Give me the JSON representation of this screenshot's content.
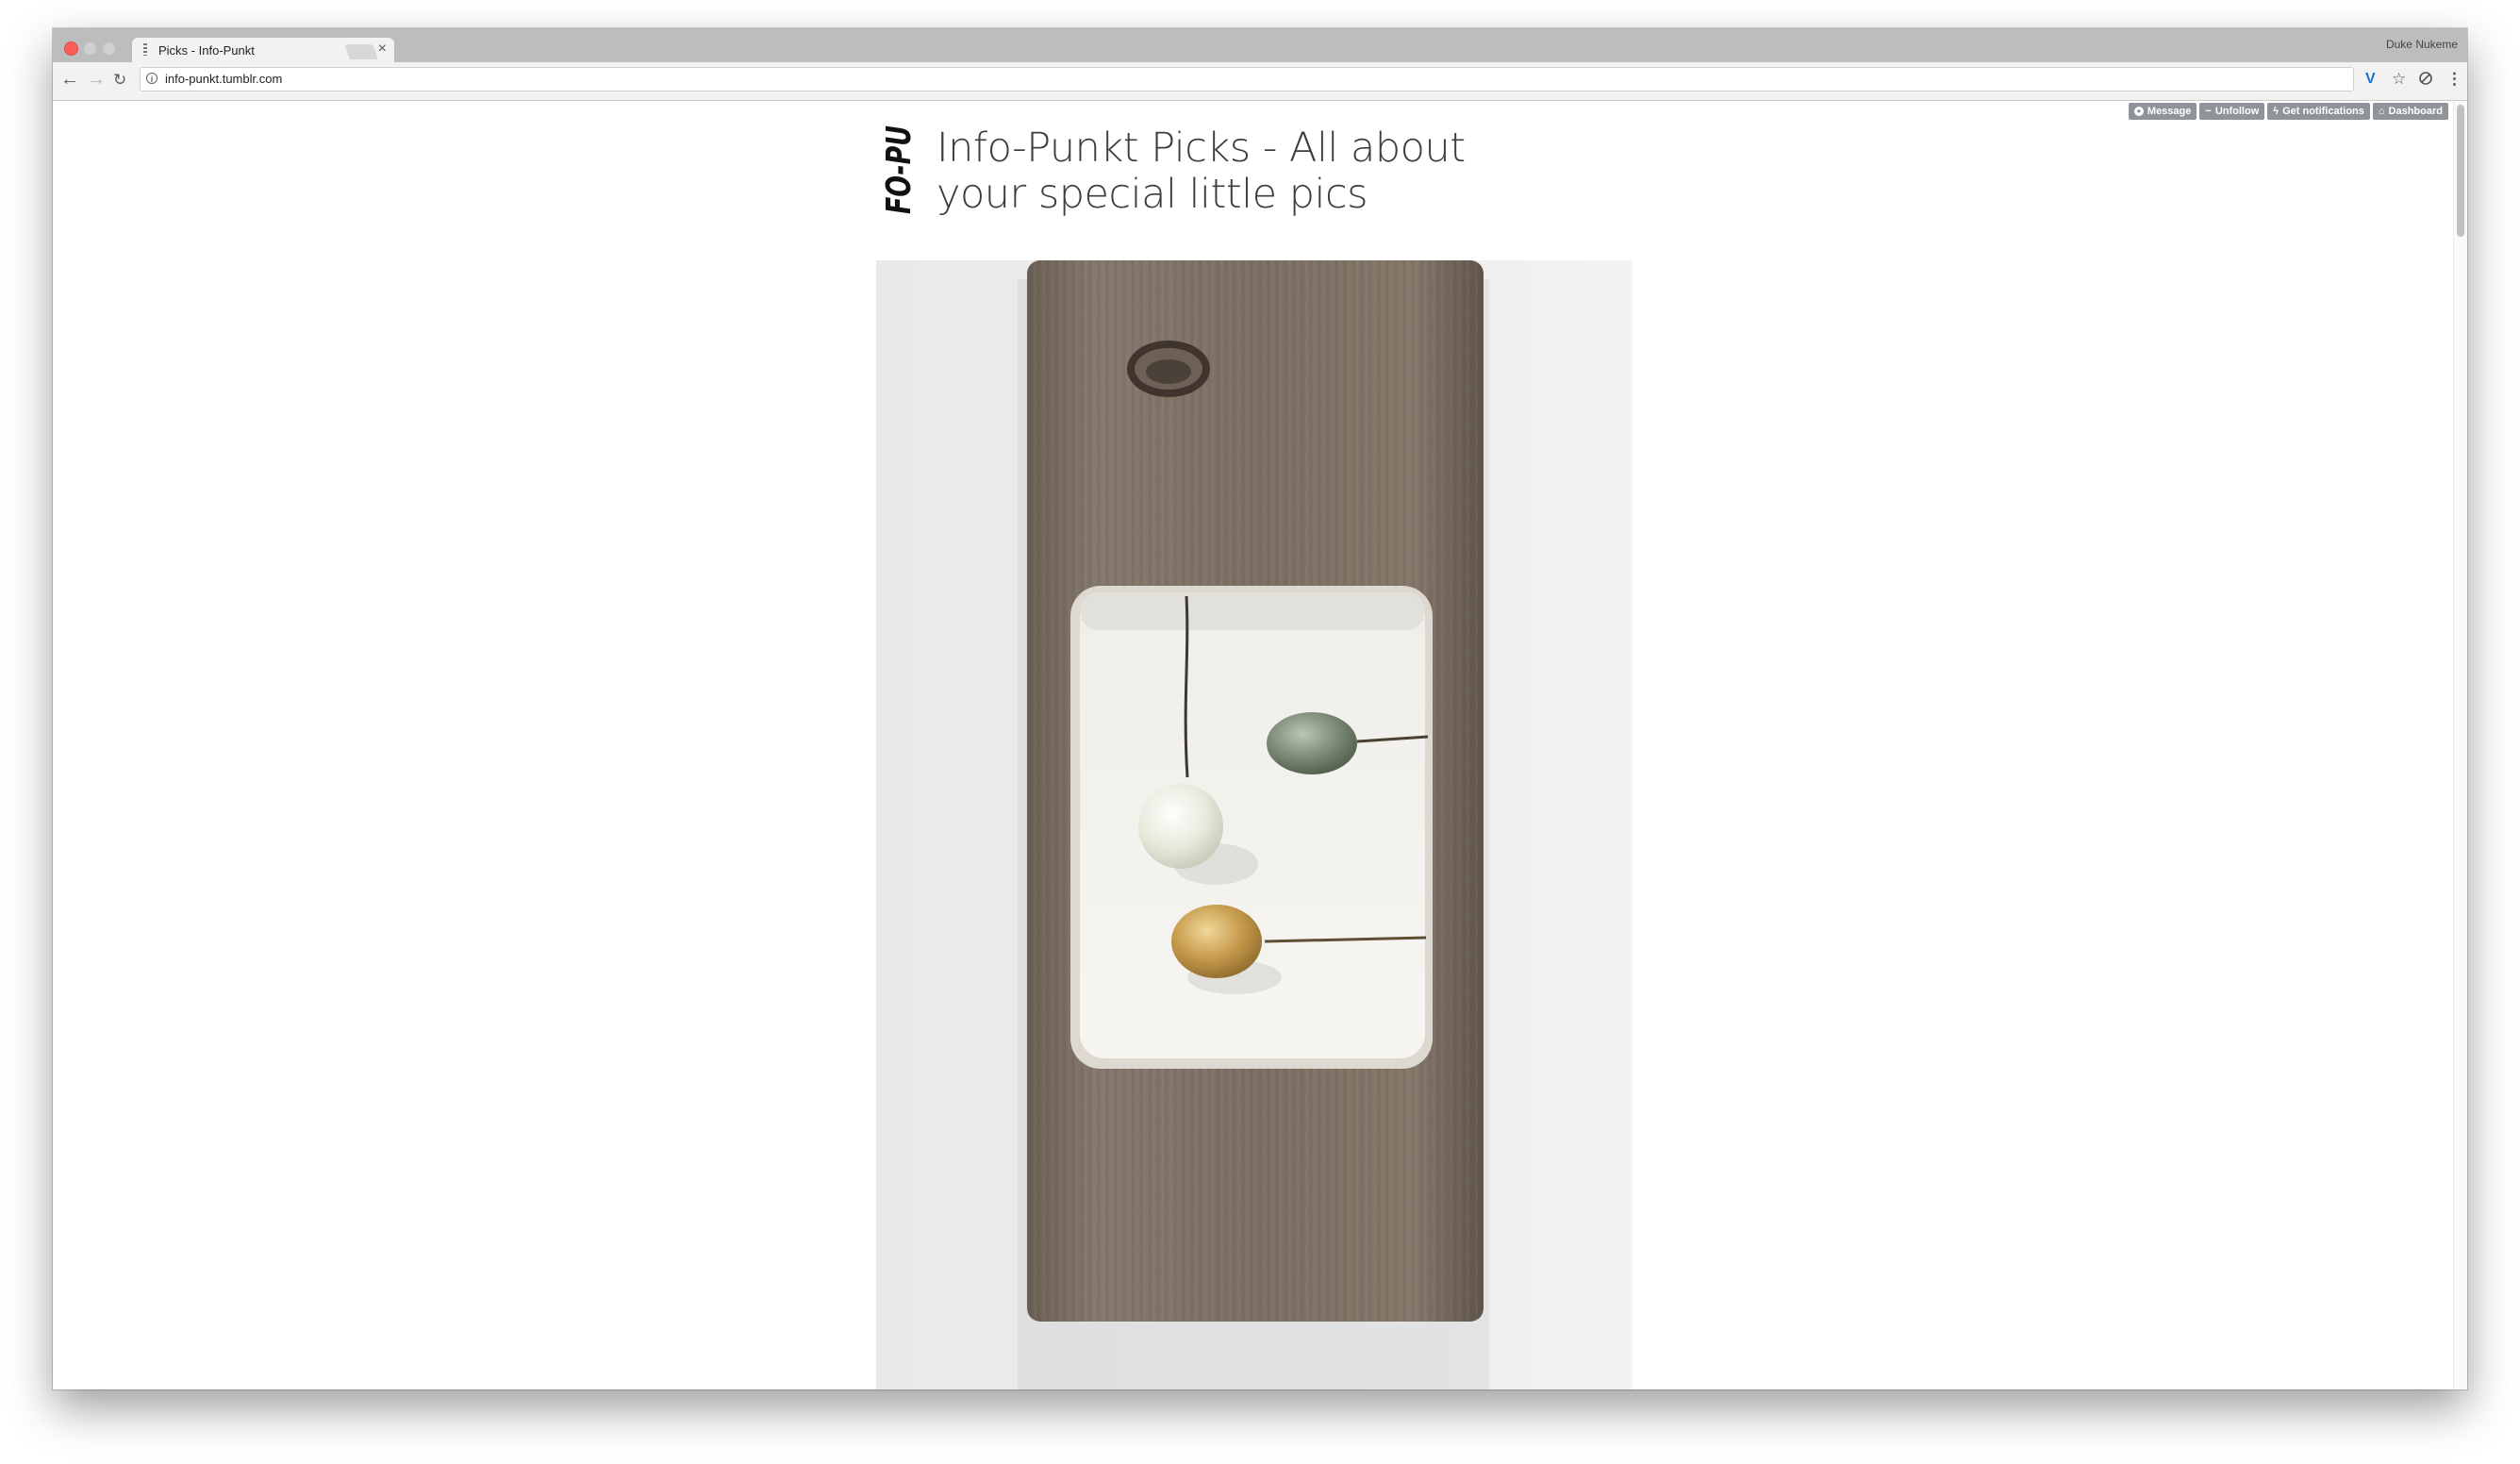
{
  "browser": {
    "tab_title": "Picks - Info-Punkt",
    "tab_close": "×",
    "profile_name": "Duke Nukeme",
    "url": "info-punkt.tumblr.com",
    "nav": {
      "back": "←",
      "forward": "→",
      "reload": "↻"
    },
    "toolbar_icons": [
      "vivaldi-extension-icon",
      "bookmark-star-icon",
      "shield-icon",
      "menu-icon"
    ]
  },
  "tumblr_controls": [
    {
      "label": "Message",
      "icon": "message-icon"
    },
    {
      "label": "Unfollow",
      "icon": "minus-icon"
    },
    {
      "label": "Get notifications",
      "icon": "lightning-icon"
    },
    {
      "label": "Dashboard",
      "icon": "home-icon"
    }
  ],
  "blog": {
    "logo_text": "FO-PU",
    "title": "Info-Punkt Picks - All about your special little pics"
  },
  "post": {
    "image_subject": "weathered wood board with carved white recess holding three pearl-headed pins"
  }
}
